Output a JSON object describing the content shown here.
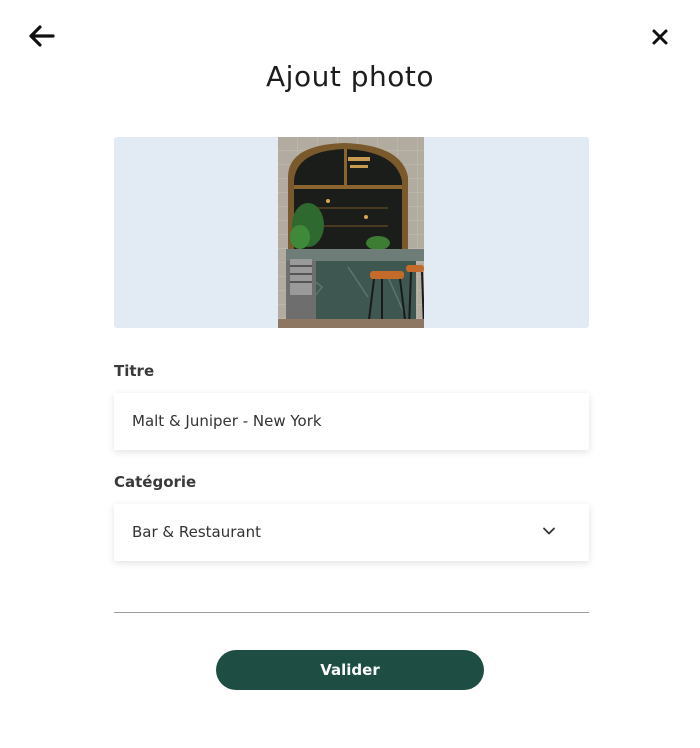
{
  "header": {
    "back_icon": "arrow-left-icon",
    "close_icon": "close-icon",
    "title": "Ajout photo"
  },
  "photo": {
    "description_icon": "storefront-photo",
    "background_color": "#e2ebf3"
  },
  "form": {
    "title_label": "Titre",
    "title_value": "Malt & Juniper - New York",
    "category_label": "Catégorie",
    "category_value": "Bar & Restaurant",
    "category_icon": "chevron-down-icon"
  },
  "actions": {
    "submit_label": "Valider",
    "submit_color": "#1e4d43"
  }
}
